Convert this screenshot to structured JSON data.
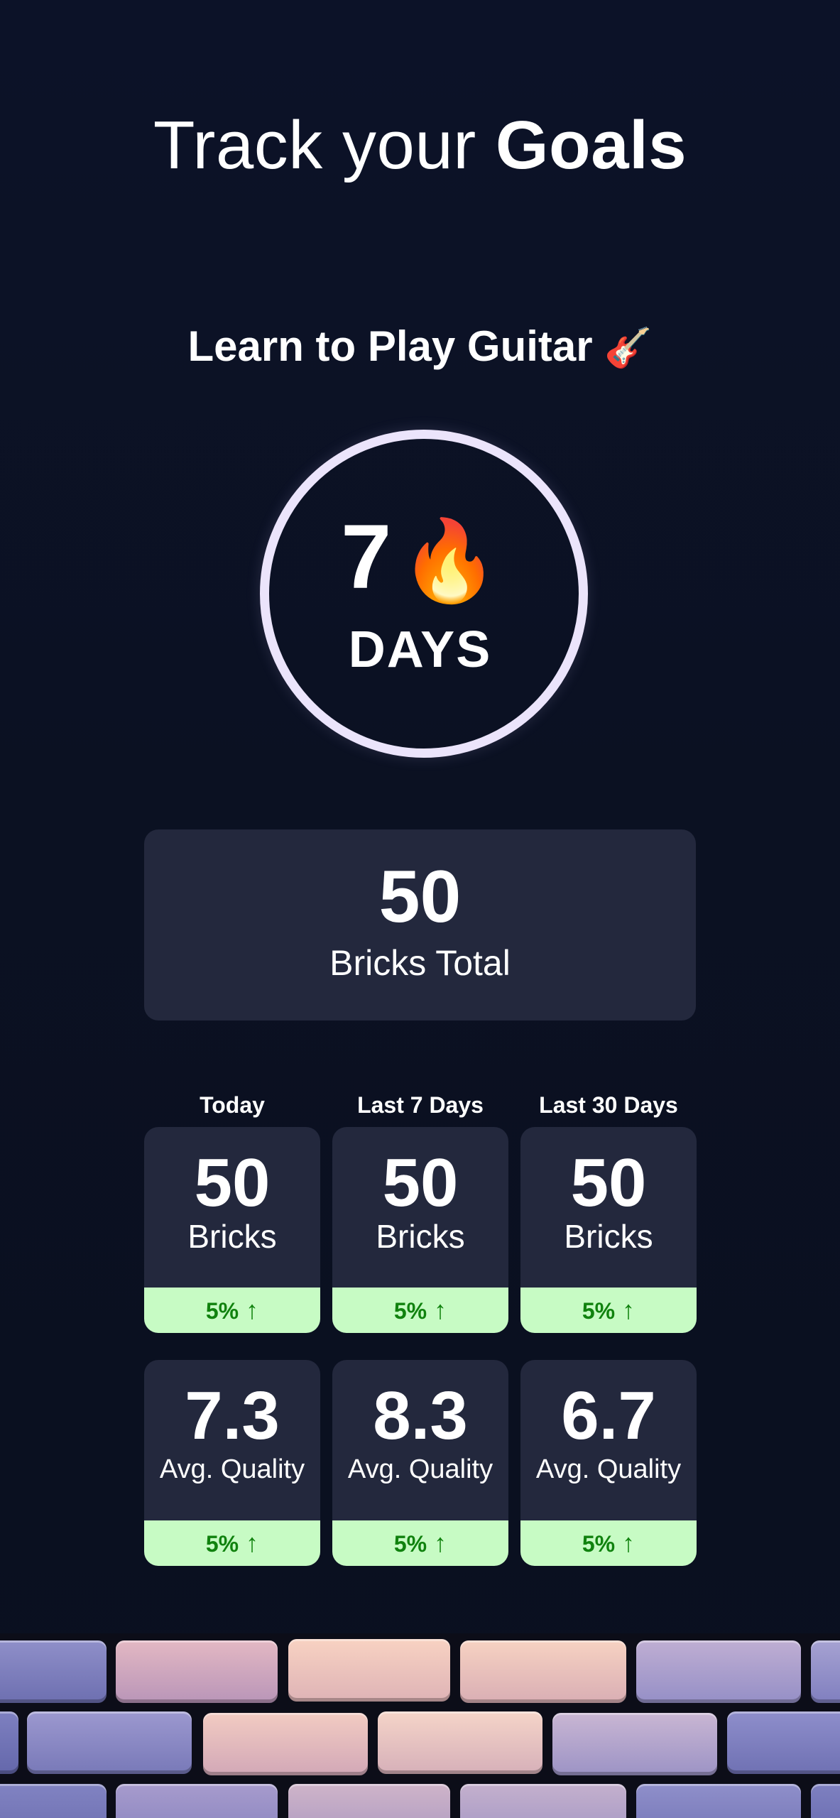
{
  "header": {
    "title_prefix": "Track your",
    "title_emphasis": "Goals"
  },
  "goal": {
    "name": "Learn to Play Guitar",
    "emoji": "🎸"
  },
  "streak": {
    "count": "7",
    "emoji": "🔥",
    "unit": "DAYS"
  },
  "total": {
    "value": "50",
    "label": "Bricks Total"
  },
  "periods": [
    {
      "label": "Today"
    },
    {
      "label": "Last 7 Days"
    },
    {
      "label": "Last 30 Days"
    }
  ],
  "brick_stats": [
    {
      "value": "50",
      "caption": "Bricks",
      "change": "5%",
      "trend_icon": "arrow-up-icon"
    },
    {
      "value": "50",
      "caption": "Bricks",
      "change": "5%",
      "trend_icon": "arrow-up-icon"
    },
    {
      "value": "50",
      "caption": "Bricks",
      "change": "5%",
      "trend_icon": "arrow-up-icon"
    }
  ],
  "quality_stats": [
    {
      "value": "7.3",
      "caption": "Avg. Quality",
      "change": "5%",
      "trend_icon": "arrow-up-icon"
    },
    {
      "value": "8.3",
      "caption": "Avg. Quality",
      "change": "5%",
      "trend_icon": "arrow-up-icon"
    },
    {
      "value": "6.7",
      "caption": "Avg. Quality",
      "change": "5%",
      "trend_icon": "arrow-up-icon"
    }
  ],
  "colors": {
    "background": "#0b1122",
    "card": "#23283d",
    "ring": "#ebe4fb",
    "change_background": "#c7fbc4",
    "change_text": "#10820e"
  }
}
